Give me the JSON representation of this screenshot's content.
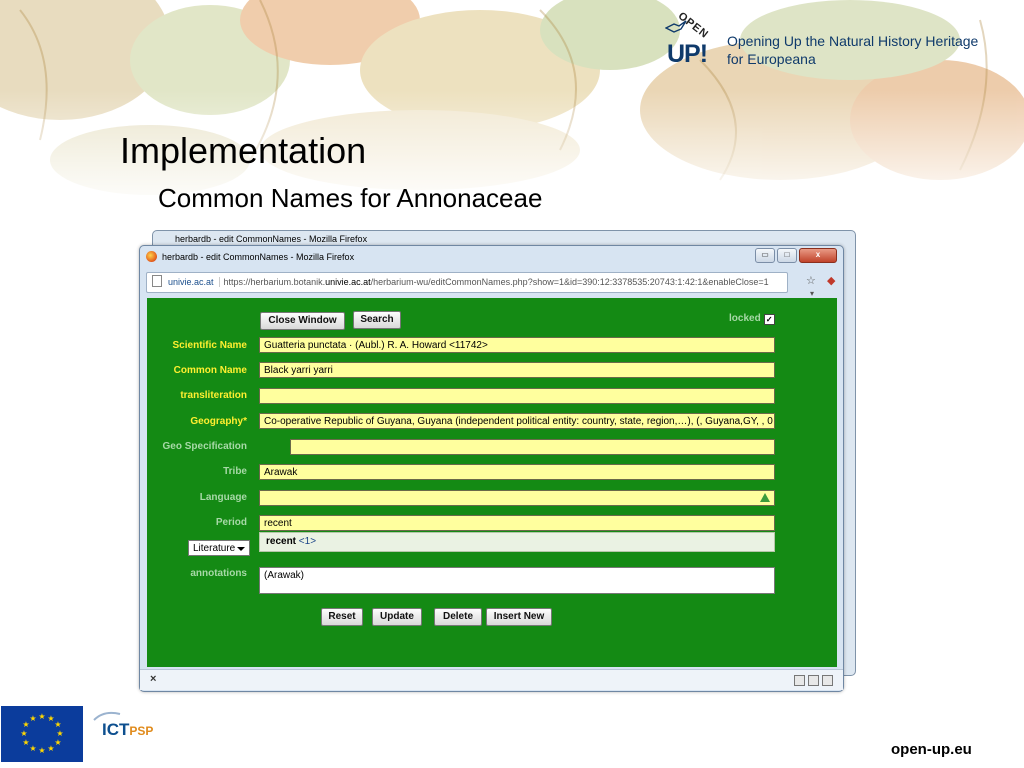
{
  "slide": {
    "brand_up": "UP!",
    "brand_open": "OPEN",
    "tagline_line1": "Opening Up the Natural History Heritage",
    "tagline_line2": "for Europeana",
    "title": "Implementation",
    "subtitle": "Common Names for Annonaceae",
    "footer_url": "open-up.eu",
    "footer_logo_ict": "ICT",
    "footer_logo_psp": "PSP"
  },
  "browser": {
    "window_title": "herbardb - edit CommonNames - Mozilla Firefox",
    "site_label": "univie.ac.at",
    "url_prefix": "https://herbarium.botanik.",
    "url_domain": "univie.ac.at",
    "url_rest": "/herbarium-wu/editCommonNames.php?show=1&id=390:12:3378535:20743:1:42:1&enableClose=1",
    "close_glyph": "x",
    "minimize_glyph": "▭",
    "maximize_glyph": "□",
    "status_close": "×"
  },
  "form": {
    "close_window_label": "Close Window",
    "search_label": "Search",
    "locked_label": "locked",
    "locked_checked": "✓",
    "labels": {
      "scientific_name": "Scientific Name",
      "common_name": "Common Name",
      "transliteration": "transliteration",
      "geography": "Geography*",
      "geo_specification": "Geo Specification",
      "tribe": "Tribe",
      "language": "Language",
      "period": "Period",
      "annotations": "annotations"
    },
    "values": {
      "scientific_name": "Guatteria punctata · (Aubl.) R. A. Howard <11742>",
      "common_name": "Black yarri yarri",
      "transliteration": "",
      "geography": "Co-operative Republic of Guyana, Guyana (independent political entity: country, state, region,…), (, Guyana,GY, , 0",
      "geo_specification": "",
      "tribe": "Arawak",
      "language": "",
      "period": "recent",
      "annotations": "(Arawak)"
    },
    "suggestion": {
      "text": "recent",
      "count": "<1>"
    },
    "literature_select": "Literature",
    "buttons": {
      "reset": "Reset",
      "update": "Update",
      "delete": "Delete",
      "insert_new": "Insert New"
    }
  },
  "colors": {
    "form_background": "#148a14",
    "field_background": "#ffff9e",
    "label_yellow": "#ffef30",
    "label_muted": "#a7d9a7"
  }
}
